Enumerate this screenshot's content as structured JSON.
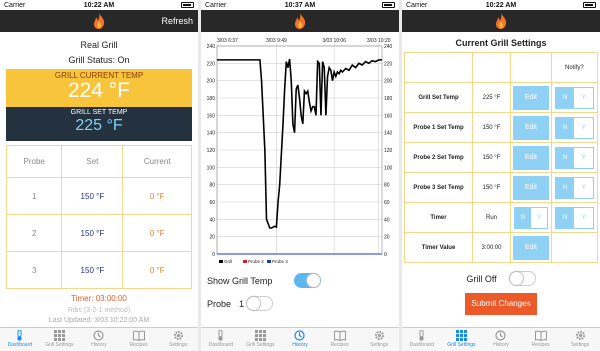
{
  "status_bars": [
    {
      "carrier": "Carrier",
      "time": "10:22 AM"
    },
    {
      "carrier": "Carrier",
      "time": "10:37 AM"
    },
    {
      "carrier": "Carrier",
      "time": "10:22 AM"
    }
  ],
  "dashboard": {
    "refresh_label": "Refresh",
    "title": "Real Grill",
    "status": "Grill Status: On",
    "current_temp_label": "GRILL CURRENT TEMP",
    "current_temp_value": "224 °F",
    "set_temp_label": "GRILL SET TEMP",
    "set_temp_value": "225 °F",
    "headers": [
      "Probe",
      "Set",
      "Current"
    ],
    "probes": [
      {
        "probe": "1",
        "set": "150 °F",
        "current": "0 °F"
      },
      {
        "probe": "2",
        "set": "150 °F",
        "current": "0 °F"
      },
      {
        "probe": "3",
        "set": "150 °F",
        "current": "0 °F"
      }
    ],
    "timer": "Timer: 03:00:00",
    "method": "Ribs (3-2-1 method)",
    "last_updated": "Last Updated: 3/03 10:22:00 AM"
  },
  "history": {
    "show_grill_temp_label": "Show Grill Temp",
    "probe_label": "Probe",
    "probe_number": "1"
  },
  "chart_data": {
    "type": "line",
    "x_tick_labels": [
      "3/03 6:37",
      "3/03 9:49",
      "3/03 10:06",
      "3/03 10:20"
    ],
    "y_ticks": [
      0,
      20,
      40,
      60,
      80,
      100,
      120,
      140,
      160,
      180,
      200,
      220,
      240
    ],
    "ylim": [
      0,
      240
    ],
    "grid": true,
    "legend": {
      "placement": "bottom",
      "entries": [
        "Grill",
        "Probe 2",
        "Probe 3"
      ]
    },
    "series": [
      {
        "name": "Grill",
        "color": "#000000",
        "x": [
          0,
          0.26,
          0.27,
          0.29,
          0.3,
          0.32,
          0.33,
          0.35,
          0.36,
          0.37,
          0.38,
          0.4,
          0.41,
          0.42,
          0.43,
          0.44,
          0.45,
          0.46,
          0.47,
          0.48,
          0.49,
          0.5,
          0.51,
          0.52,
          0.53,
          0.54,
          0.55,
          0.56,
          0.57,
          0.58,
          0.59,
          0.6,
          0.61,
          0.62,
          0.63,
          0.64,
          0.65,
          0.66,
          0.67,
          0.68,
          0.69,
          0.7,
          0.71,
          0.72,
          0.73,
          0.74,
          0.75,
          0.76,
          0.78,
          0.8,
          0.82,
          0.84,
          0.86,
          0.88,
          0.9,
          0.92,
          0.94,
          0.96,
          0.98,
          1.0
        ],
        "y": [
          224,
          224,
          200,
          120,
          40,
          30,
          30,
          32,
          31,
          60,
          80,
          150,
          190,
          222,
          215,
          225,
          200,
          150,
          140,
          190,
          195,
          180,
          160,
          150,
          188,
          185,
          188,
          175,
          165,
          170,
          170,
          160,
          222,
          220,
          160,
          222,
          215,
          160,
          205,
          215,
          212,
          200,
          210,
          205,
          210,
          208,
          212,
          210,
          214,
          212,
          218,
          215,
          220,
          218,
          222,
          220,
          223,
          222,
          224,
          224
        ]
      },
      {
        "name": "Probe 2",
        "color": "#d42020",
        "x": [
          0,
          1.0
        ],
        "y": [
          0,
          0
        ]
      },
      {
        "name": "Probe 3",
        "color": "#1a3ad4",
        "x": [
          0,
          1.0
        ],
        "y": [
          0,
          0
        ]
      }
    ]
  },
  "settings": {
    "title": "Current Grill Settings",
    "notify_header": "Notify?",
    "rows": [
      {
        "label": "Grill Set Temp",
        "value": "225 °F",
        "action": "Edit",
        "n": "N",
        "y": "Y"
      },
      {
        "label": "Probe 1 Set Temp",
        "value": "150 °F",
        "action": "Edit",
        "n": "N",
        "y": "Y"
      },
      {
        "label": "Probe 2 Set Temp",
        "value": "150 °F",
        "action": "Edit",
        "n": "N",
        "y": "Y"
      },
      {
        "label": "Probe 3 Set Temp",
        "value": "150 °F",
        "action": "Edit",
        "n": "N",
        "y": "Y"
      },
      {
        "label": "Timer",
        "value": "Run",
        "n": "N",
        "y": "Y",
        "n2": "N",
        "y2": "Y"
      },
      {
        "label": "Timer Value",
        "value": "3:00:00",
        "action": "Edit"
      }
    ],
    "grill_off_label": "Grill Off",
    "submit_label": "Submit Changes"
  },
  "tabs": [
    "Dashboard",
    "Grill Settings",
    "History",
    "Recipes",
    "Settings"
  ],
  "active_tabs": [
    "Dashboard",
    "History",
    "Grill Settings"
  ],
  "colors": {
    "accent": "#1e88e5",
    "flame": "#f2722a",
    "current_temp_bg": "#f7c43c",
    "set_temp_bg": "#24323f",
    "submit": "#ed5a2a",
    "toggle_on": "#5bb7ee"
  }
}
